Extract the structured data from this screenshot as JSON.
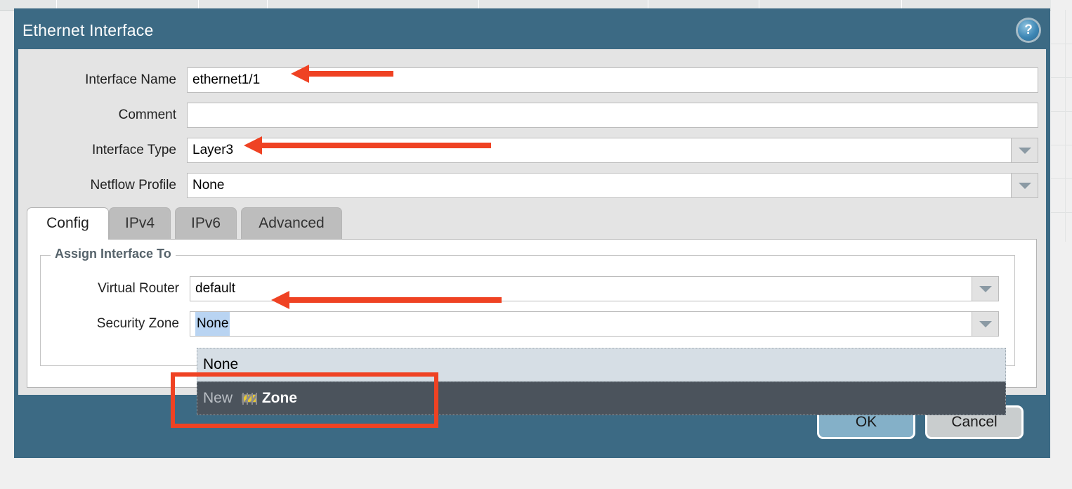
{
  "dialog": {
    "title": "Ethernet Interface",
    "help_icon": "help-circle-icon",
    "accent_color": "#3c6a84",
    "annotation_color": "#ef4223"
  },
  "form": {
    "fields": [
      {
        "label": "Interface Name",
        "value": "ethernet1/1",
        "type": "text",
        "annotated": true
      },
      {
        "label": "Comment",
        "value": "",
        "type": "text",
        "annotated": false
      },
      {
        "label": "Interface Type",
        "value": "Layer3",
        "type": "select",
        "annotated": true
      },
      {
        "label": "Netflow Profile",
        "value": "None",
        "type": "select",
        "annotated": false
      }
    ]
  },
  "tabs": [
    {
      "label": "Config",
      "active": true
    },
    {
      "label": "IPv4",
      "active": false
    },
    {
      "label": "IPv6",
      "active": false
    },
    {
      "label": "Advanced",
      "active": false
    }
  ],
  "config_tab": {
    "group_title": "Assign Interface To",
    "fields": [
      {
        "label": "Virtual Router",
        "value": "default",
        "type": "select",
        "annotated": true
      },
      {
        "label": "Security Zone",
        "value": "None",
        "type": "select",
        "selected_text": true,
        "annotated": false
      }
    ]
  },
  "dropdown": {
    "open": true,
    "items": [
      {
        "label": "None",
        "highlighted": false,
        "icon": null
      },
      {
        "label_prefix": "New",
        "icon": "zone-barrier-icon",
        "label_suffix": "Zone",
        "highlighted": true
      }
    ]
  },
  "footer": {
    "ok_label": "OK",
    "cancel_label": "Cancel"
  }
}
